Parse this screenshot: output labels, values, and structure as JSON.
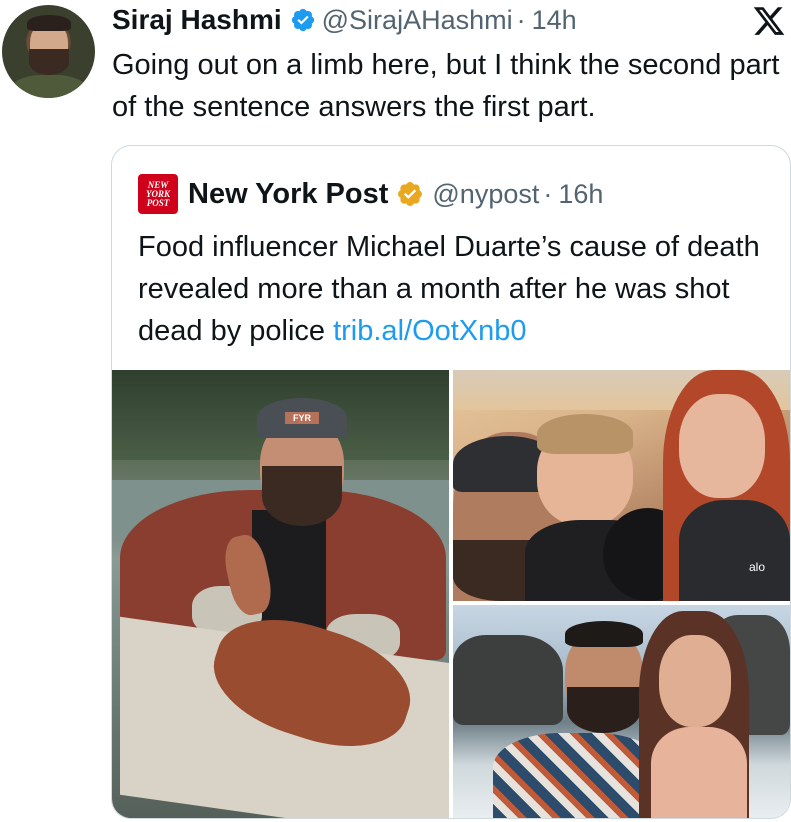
{
  "tweet": {
    "author_name": "Siraj Hashmi",
    "handle": "@SirajAHashmi",
    "separator": "·",
    "time": "14h",
    "text": "Going out on a limb here, but I think the second part of the sentence answers the first part."
  },
  "quoted_tweet": {
    "logo_lines": [
      "NEW",
      "YORK",
      "POST"
    ],
    "author_name": "New York Post",
    "handle": "@nypost",
    "separator": "·",
    "time": "16h",
    "text": "Food influencer Michael Duarte’s cause of death revealed more than a month after he was shot dead by police",
    "link": "trib.al/OotXnb0"
  },
  "photos": {
    "cap_text": "FYR",
    "shirt_text": "alo"
  },
  "colors": {
    "verified_blue": "#1d9bf0",
    "gold_badge": "#e8a820",
    "link_blue": "#1d9bf0",
    "nyp_red": "#d0021b",
    "muted_text": "#536471"
  }
}
